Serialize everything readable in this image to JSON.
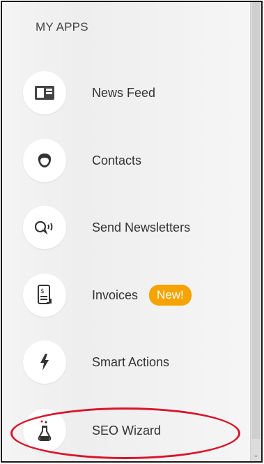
{
  "header": {
    "title": "MY APPS"
  },
  "apps": [
    {
      "label": "News Feed",
      "icon": "news-feed-icon"
    },
    {
      "label": "Contacts",
      "icon": "contacts-icon"
    },
    {
      "label": "Send Newsletters",
      "icon": "newsletter-icon"
    },
    {
      "label": "Invoices",
      "icon": "invoice-icon",
      "badge": "New!"
    },
    {
      "label": "Smart Actions",
      "icon": "lightning-icon"
    },
    {
      "label": "SEO Wizard",
      "icon": "flask-icon"
    }
  ],
  "colors": {
    "badge": "#f5a300",
    "highlight": "#d8142a"
  },
  "scrollbar": {
    "down_arrow": "⌄"
  }
}
